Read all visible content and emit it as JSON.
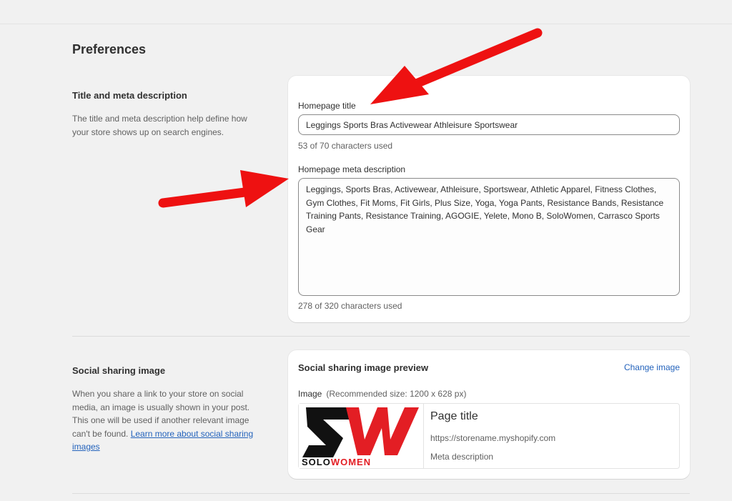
{
  "page": {
    "heading": "Preferences"
  },
  "title_section": {
    "heading": "Title and meta description",
    "description": "The title and meta description help define how your store shows up on search engines.",
    "homepage_title_label": "Homepage title",
    "homepage_title_value": "Leggings Sports Bras Activewear Athleisure Sportswear",
    "title_counter": "53 of 70 characters used",
    "meta_label": "Homepage meta description",
    "meta_value": "Leggings, Sports Bras, Activewear, Athleisure, Sportswear, Athletic Apparel, Fitness Clothes, Gym Clothes, Fit Moms, Fit Girls, Plus Size, Yoga, Yoga Pants, Resistance Bands, Resistance Training Pants, Resistance Training, AGOGIE, Yelete, Mono B, SoloWomen, Carrasco Sports Gear",
    "meta_counter": "278 of 320 characters used"
  },
  "social_section": {
    "heading": "Social sharing image",
    "description_text": "When you share a link to your store on social media, an image is usually shown in your post. This one will be used if another relevant image can't be found. ",
    "learn_more_link": "Learn more about social sharing images",
    "card_title": "Social sharing image preview",
    "change_image_label": "Change image",
    "image_label": "Image",
    "image_recommendation": "(Recommended size: 1200 x 628 px)",
    "preview": {
      "page_title": "Page title",
      "url": "https://storename.myshopify.com",
      "meta_description": "Meta description",
      "logo": {
        "monogram": "SW",
        "wordmark_a": "SOLO",
        "wordmark_b": "WOMEN"
      }
    }
  },
  "colors": {
    "arrow": "#ee1111",
    "link": "#2463bc",
    "logo_black": "#111111",
    "logo_red": "#e31e24"
  }
}
